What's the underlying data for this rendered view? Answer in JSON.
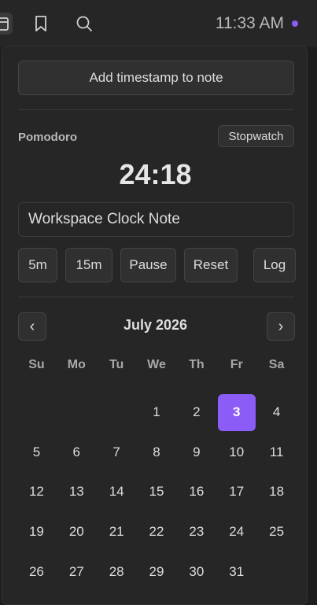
{
  "topbar": {
    "icons": [
      "calendar-icon",
      "bookmark-icon",
      "search-icon"
    ],
    "clock": "11:33 AM",
    "status_dot_color": "#8b5cf6"
  },
  "actions": {
    "add_timestamp_label": "Add timestamp to note"
  },
  "pomodoro": {
    "label": "Pomodoro",
    "stopwatch_label": "Stopwatch",
    "timer": "24:18",
    "note_value": "Workspace Clock Note",
    "controls": {
      "five_min": "5m",
      "fifteen_min": "15m",
      "pause": "Pause",
      "reset": "Reset",
      "log": "Log"
    }
  },
  "calendar": {
    "prev_label": "‹",
    "next_label": "›",
    "month_title": "July 2026",
    "weekdays": [
      "Su",
      "Mo",
      "Tu",
      "We",
      "Th",
      "Fr",
      "Sa"
    ],
    "leading_blanks": 3,
    "days": [
      "1",
      "2",
      "3",
      "4",
      "5",
      "6",
      "7",
      "8",
      "9",
      "10",
      "11",
      "12",
      "13",
      "14",
      "15",
      "16",
      "17",
      "18",
      "19",
      "20",
      "21",
      "22",
      "23",
      "24",
      "25",
      "26",
      "27",
      "28",
      "29",
      "30",
      "31"
    ],
    "selected_day": "3",
    "accent_color": "#8b5cf6"
  }
}
